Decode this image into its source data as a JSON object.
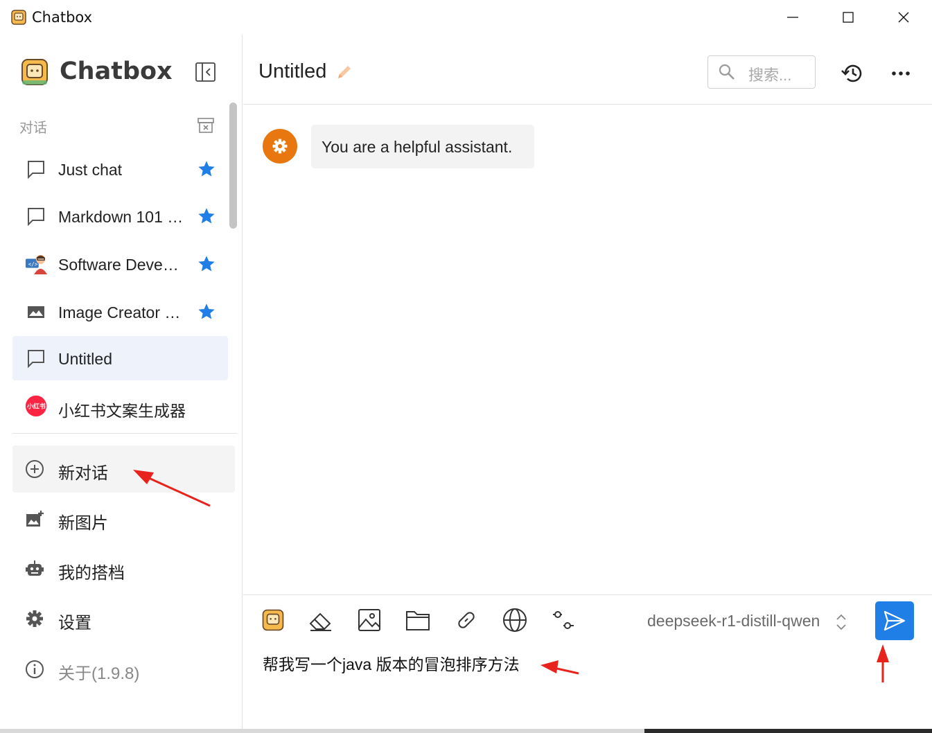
{
  "window": {
    "title": "Chatbox"
  },
  "sidebar": {
    "brand": "Chatbox",
    "section_label": "对话",
    "conversations": [
      {
        "label": "Just chat",
        "icon": "chat-bubble-icon",
        "starred": true
      },
      {
        "label": "Markdown 101 (Example)",
        "icon": "chat-bubble-icon",
        "starred": true
      },
      {
        "label": "Software Developer",
        "icon": "developer-avatar-icon",
        "starred": true
      },
      {
        "label": "Image Creator (Example)",
        "icon": "image-icon",
        "starred": true
      },
      {
        "label": "Untitled",
        "icon": "chat-bubble-icon",
        "starred": false,
        "active": true
      },
      {
        "label": "小红书文案生成器",
        "icon": "xiaohongshu-logo-icon",
        "starred": false
      }
    ],
    "menu": [
      {
        "label": "新对话",
        "icon": "add-circle-icon"
      },
      {
        "label": "新图片",
        "icon": "add-image-icon"
      },
      {
        "label": "我的搭档",
        "icon": "robot-icon"
      },
      {
        "label": "设置",
        "icon": "gear-icon"
      },
      {
        "label": "关于(1.9.8)",
        "icon": "info-icon"
      }
    ]
  },
  "header": {
    "title": "Untitled",
    "search_placeholder": "搜索..."
  },
  "messages": [
    {
      "role": "system",
      "text": "You are a helpful assistant."
    }
  ],
  "composer": {
    "model": "deepseek-r1-distill-qwen",
    "text": "帮我写一个java 版本的冒泡排序方法"
  },
  "colors": {
    "accent": "#1f7fe6",
    "star": "#1f7fe6",
    "system_avatar": "#e8770f",
    "annotation_arrow": "#e8221c"
  }
}
